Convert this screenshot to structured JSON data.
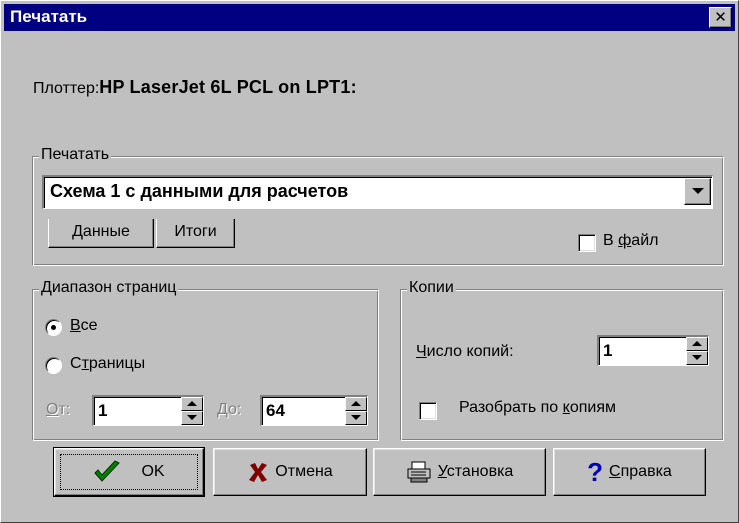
{
  "window": {
    "title": "Печатать",
    "close_glyph": "✕"
  },
  "plotter": {
    "label": "Плоттер:",
    "value": "HP LaserJet 6L PCL on LPT1:"
  },
  "print_group": {
    "legend": "Печатать",
    "selected": "Схема 1 с данными для расчетов",
    "tabs": [
      {
        "label": "Данные",
        "active": true
      },
      {
        "label": "Итоги",
        "active": false
      }
    ],
    "to_file": {
      "label_pre": "В ",
      "label_u": "ф",
      "label_post": "айл",
      "checked": false
    }
  },
  "range_group": {
    "legend": "Диапазон страниц",
    "options": [
      {
        "label_u": "В",
        "label_post": "се",
        "selected": true
      },
      {
        "label_pre": "С",
        "label_u": "т",
        "label_post": "раницы",
        "selected": false
      }
    ],
    "from_label_u": "О",
    "from_label_post": "т:",
    "from_value": "1",
    "to_label_u": "Д",
    "to_label_post": "о:",
    "to_value": "64"
  },
  "copies_group": {
    "legend": "Копии",
    "count_label_u": "Ч",
    "count_label_post": "исло копий:",
    "count_value": "1",
    "collate": {
      "label_pre": "Разобрать по ",
      "label_u": "к",
      "label_post": "опиям",
      "checked": false
    }
  },
  "buttons": {
    "ok": {
      "label": "OK",
      "icon": "check-icon",
      "color": "#008000"
    },
    "cancel": {
      "label": "Отмена",
      "icon": "x-icon",
      "color": "#800000"
    },
    "setup": {
      "label_u": "У",
      "label_post": "становка",
      "icon": "printer-icon"
    },
    "help": {
      "label_u": "С",
      "label_post": "правка",
      "icon": "question-icon",
      "color": "#0000c0"
    }
  },
  "colors": {
    "titlebar": "#000080",
    "face": "#c0c0c0"
  }
}
